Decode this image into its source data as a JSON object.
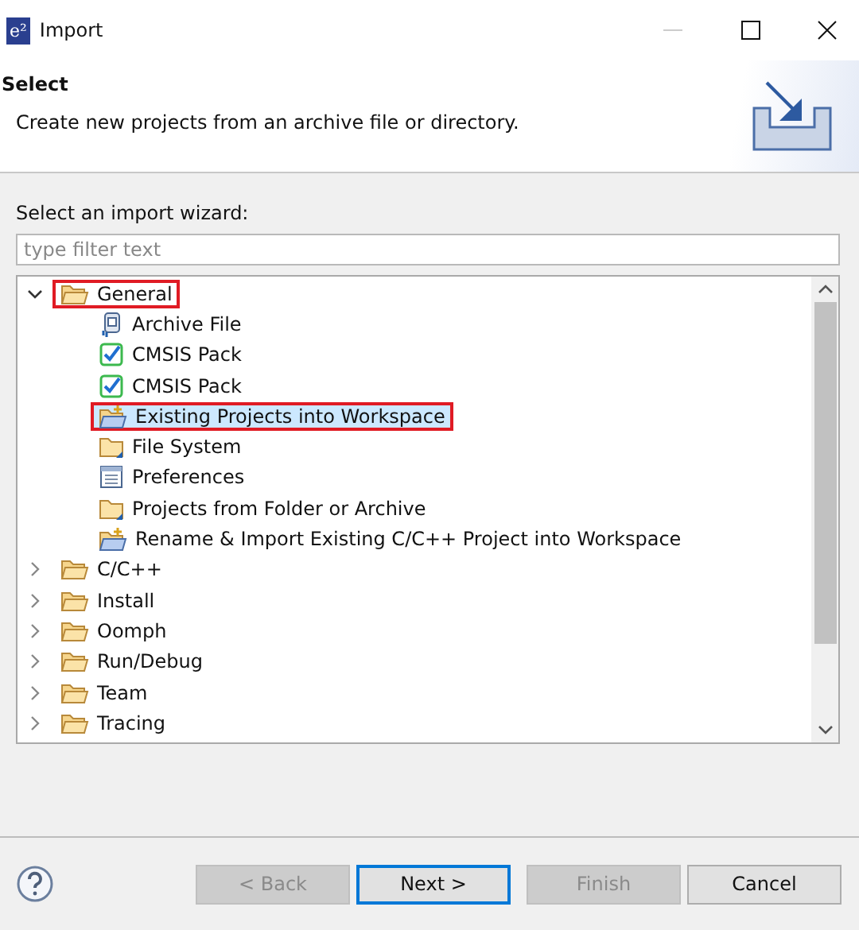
{
  "window": {
    "title": "Import",
    "logo": "e²"
  },
  "header": {
    "title": "Select",
    "description": "Create new projects from an archive file or directory."
  },
  "wizard_label": "Select an import wizard:",
  "filter": {
    "placeholder": "type filter text"
  },
  "tree": [
    {
      "label": "General",
      "kind": "folder",
      "expanded": true,
      "selected": false,
      "highlighted": true,
      "children": [
        {
          "label": "Archive File",
          "kind": "archive",
          "selected": false,
          "highlighted": false
        },
        {
          "label": "CMSIS Pack",
          "kind": "check",
          "selected": false,
          "highlighted": false
        },
        {
          "label": "CMSIS Pack",
          "kind": "check",
          "selected": false,
          "highlighted": false
        },
        {
          "label": "Existing Projects into Workspace",
          "kind": "project",
          "selected": true,
          "highlighted": true
        },
        {
          "label": "File System",
          "kind": "filefolder",
          "selected": false,
          "highlighted": false
        },
        {
          "label": "Preferences",
          "kind": "prefs",
          "selected": false,
          "highlighted": false
        },
        {
          "label": "Projects from Folder or Archive",
          "kind": "filefolder",
          "selected": false,
          "highlighted": false
        },
        {
          "label": "Rename & Import Existing C/C++ Project into Workspace",
          "kind": "project",
          "selected": false,
          "highlighted": false
        }
      ]
    },
    {
      "label": "C/C++",
      "kind": "folder",
      "expanded": false,
      "selected": false,
      "highlighted": false
    },
    {
      "label": "Install",
      "kind": "folder",
      "expanded": false,
      "selected": false,
      "highlighted": false
    },
    {
      "label": "Oomph",
      "kind": "folder",
      "expanded": false,
      "selected": false,
      "highlighted": false
    },
    {
      "label": "Run/Debug",
      "kind": "folder",
      "expanded": false,
      "selected": false,
      "highlighted": false
    },
    {
      "label": "Team",
      "kind": "folder",
      "expanded": false,
      "selected": false,
      "highlighted": false
    },
    {
      "label": "Tracing",
      "kind": "folder",
      "expanded": false,
      "selected": false,
      "highlighted": false
    }
  ],
  "buttons": [
    {
      "label": "< Back",
      "disabled": true,
      "default": false
    },
    {
      "label": "Next >",
      "disabled": false,
      "default": true
    },
    {
      "label": "Finish",
      "disabled": true,
      "default": false
    },
    {
      "label": "Cancel",
      "disabled": false,
      "default": false
    }
  ]
}
